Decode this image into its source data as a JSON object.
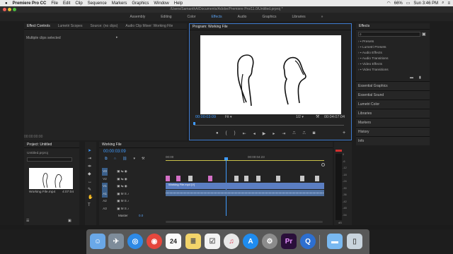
{
  "menubar": {
    "apple": "",
    "app_name": "Premiere Pro CC",
    "items": [
      "File",
      "Edit",
      "Clip",
      "Sequence",
      "Markers",
      "Graphics",
      "Window",
      "Help"
    ],
    "battery": "66%",
    "clock": "Sun 3:46 PM"
  },
  "window": {
    "path": "/Users/SamanthA/Documents/Adobe/Premiere Pro/11.0/Untitled.prproj *"
  },
  "workspaces": {
    "tabs": [
      "Assembly",
      "Editing",
      "Color",
      "Effects",
      "Audio",
      "Graphics",
      "Libraries"
    ],
    "active": "Effects",
    "more": "»"
  },
  "source_panel": {
    "tabs": [
      "Effect Controls",
      "Lumetri Scopes",
      "Source: (no clips)",
      "Audio Clip Mixer: Working File"
    ],
    "message": "Multiple clips selected",
    "timecode": "00:00:00:00"
  },
  "program": {
    "title": "Program: Working File",
    "timecode": "00:00:03:09",
    "fit": "Fit",
    "resolution": "1/2",
    "duration": "00:04:07:04"
  },
  "effects": {
    "title": "Effects",
    "items": [
      "Presets",
      "Lumetri Presets",
      "Audio Effects",
      "Audio Transitions",
      "Video Effects",
      "Video Transitions"
    ],
    "panels": [
      "Essential Graphics",
      "Essential Sound",
      "Lumetri Color",
      "Libraries",
      "Markers",
      "History",
      "Info"
    ]
  },
  "project": {
    "title": "Project: Untitled",
    "file": "Untitled.prproj",
    "clip_name": "Working File.mp4",
    "clip_duration": "4:07:04"
  },
  "timeline": {
    "title": "Working File",
    "timecode": "00:00:03:09",
    "ruler": [
      "00:00",
      "00:00:04:23"
    ],
    "track_labels": [
      "V3",
      "V2",
      "V1",
      "A1",
      "A2",
      "A3"
    ],
    "clip_label": "Working File.mp4 [V]",
    "master": "Master",
    "master_value": "0.0"
  },
  "meters": {
    "labels": [
      "0",
      "-6",
      "-12",
      "-18",
      "-24",
      "-30",
      "-36",
      "-42",
      "-48",
      "-54"
    ],
    "peak": "dB"
  },
  "dock": {
    "apps": [
      "Finder",
      "Launchpad",
      "Safari",
      "Chrome",
      "Calendar",
      "Notes",
      "Reminders",
      "Music",
      "App Store",
      "Preferences",
      "Premiere",
      "QuickTime",
      "Folder",
      "Trash"
    ]
  }
}
